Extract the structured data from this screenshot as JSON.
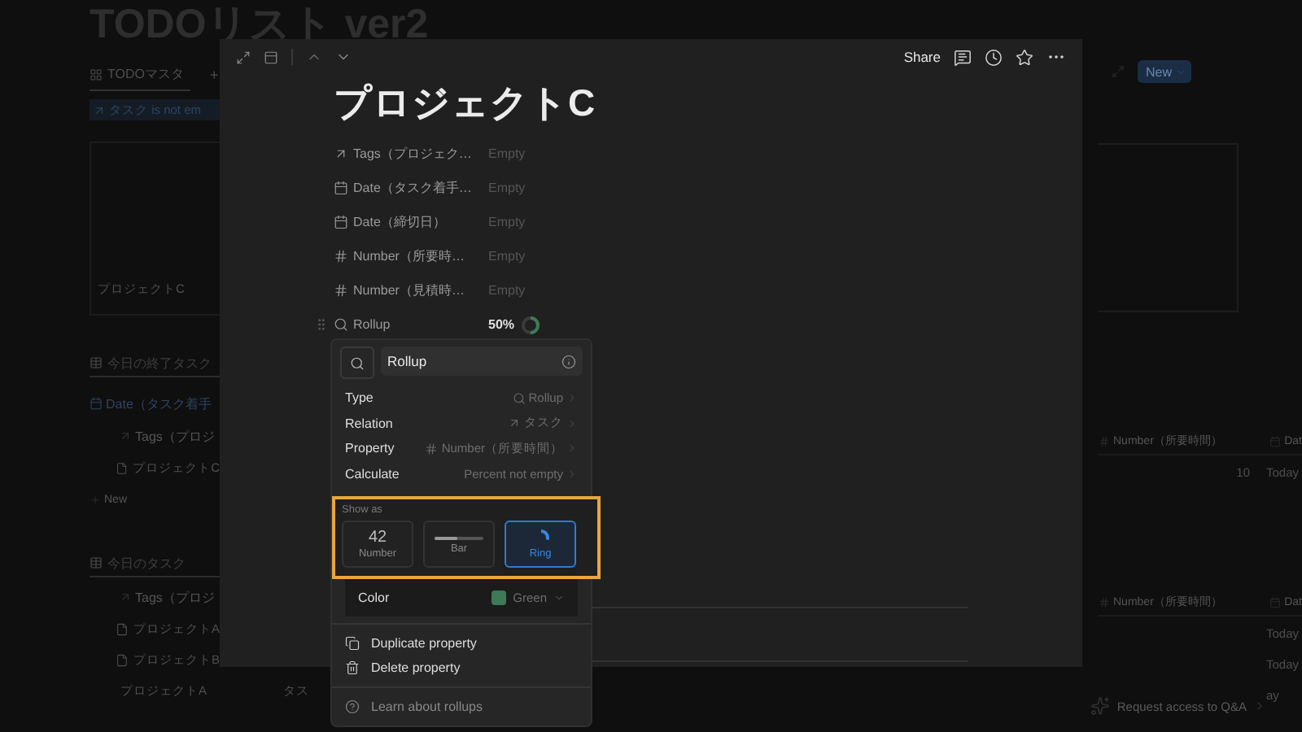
{
  "background_page": {
    "title": "TODOリスト ver2",
    "view_tab": {
      "label": "TODOマスタ",
      "add": "+"
    },
    "filter_chip": "タスク is not em",
    "left_column": [
      {
        "kind": "card",
        "text": "プロジェクトC"
      },
      {
        "kind": "heading",
        "text": "今日の終了タスク"
      },
      {
        "kind": "group",
        "text": "Date（タスク着手"
      },
      {
        "kind": "column",
        "text": "Tags（プロジ"
      },
      {
        "kind": "page",
        "text": "プロジェクトC"
      },
      {
        "kind": "new",
        "text": "New"
      },
      {
        "kind": "heading",
        "text": "今日のタスク"
      },
      {
        "kind": "column",
        "text": "Tags（プロジ"
      },
      {
        "kind": "page",
        "text": "プロジェクトA"
      },
      {
        "kind": "page",
        "text": "プロジェクトB"
      },
      {
        "kind": "page",
        "text": "プロジェクトA",
        "extra": "タス"
      }
    ],
    "new_button": "New",
    "tables": [
      {
        "header": "Number（所要時間）",
        "header_2": "Dat",
        "rows": [
          {
            "number": "10",
            "date": "Today"
          }
        ]
      },
      {
        "header": "Number（所要時間）",
        "header_2": "Dat",
        "rows": [
          {
            "date": "Today"
          },
          {
            "date": "Today"
          },
          {
            "date": "ay"
          }
        ]
      }
    ],
    "request_access": "Request access to Q&A"
  },
  "modal": {
    "actions": [
      {
        "kind": "text",
        "label": "Share"
      },
      {
        "kind": "comment"
      },
      {
        "kind": "history"
      },
      {
        "kind": "favorite"
      },
      {
        "kind": "more"
      }
    ],
    "title": "プロジェクトC",
    "properties": [
      {
        "kind": "relation",
        "name": "Tags（プロジェク…",
        "value": "Empty"
      },
      {
        "kind": "date",
        "name": "Date（タスク着手…",
        "value": "Empty"
      },
      {
        "kind": "date",
        "name": "Date（締切日）",
        "value": "Empty"
      },
      {
        "kind": "number",
        "name": "Number（所要時…",
        "value": "Empty"
      },
      {
        "kind": "number",
        "name": "Number（見積時…",
        "value": "Empty"
      },
      {
        "kind": "rollup",
        "name": "Rollup",
        "value": "50%",
        "level": 0.5
      }
    ]
  },
  "popover": {
    "name_field": {
      "value": "Rollup"
    },
    "settings": [
      {
        "kind": "rollup",
        "label": "Type",
        "value": "Rollup"
      },
      {
        "kind": "relation",
        "label": "Relation",
        "value": "タスク"
      },
      {
        "kind": "number",
        "label": "Property",
        "value": "Number（所要時間）"
      },
      {
        "kind": "plain",
        "label": "Calculate",
        "value": "Percent not empty"
      }
    ],
    "show_as": {
      "label": "Show as",
      "highlighted": true,
      "options": [
        {
          "kind": "number",
          "sample": "42",
          "label": "Number",
          "selected": false
        },
        {
          "kind": "bar",
          "label": "Bar",
          "selected": false
        },
        {
          "kind": "ring",
          "label": "Ring",
          "selected": true
        }
      ]
    },
    "color_setting": {
      "label": "Color",
      "value": "Green",
      "color": "#3d7a55"
    },
    "actions": [
      {
        "kind": "duplicate",
        "label": "Duplicate property"
      },
      {
        "kind": "delete",
        "label": "Delete property"
      }
    ],
    "help": "Learn about rollups"
  }
}
